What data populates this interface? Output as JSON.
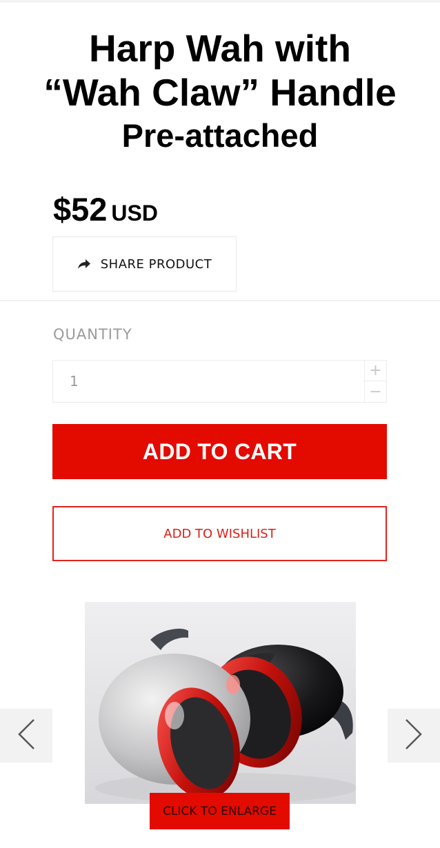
{
  "product": {
    "title_line1": "Harp Wah with",
    "title_line2": "“Wah Claw” Handle",
    "title_line3": "Pre-attached",
    "price_amount": "$52",
    "price_currency": "USD"
  },
  "share": {
    "label": "SHARE PRODUCT",
    "icon": "share-arrow-icon"
  },
  "quantity": {
    "label": "QUANTITY",
    "value": "1",
    "plus": "+",
    "minus": "−"
  },
  "actions": {
    "add_to_cart": "ADD TO CART",
    "add_to_wishlist": "ADD TO WISHLIST"
  },
  "gallery": {
    "enlarge_label": "CLICK TO ENLARGE",
    "prev_icon": "chevron-left-icon",
    "next_icon": "chevron-right-icon",
    "image_alt": "silver and black harp wah with red inner rings and handles"
  },
  "colors": {
    "accent": "#e30b00",
    "wishlist_border": "#e0231b"
  }
}
